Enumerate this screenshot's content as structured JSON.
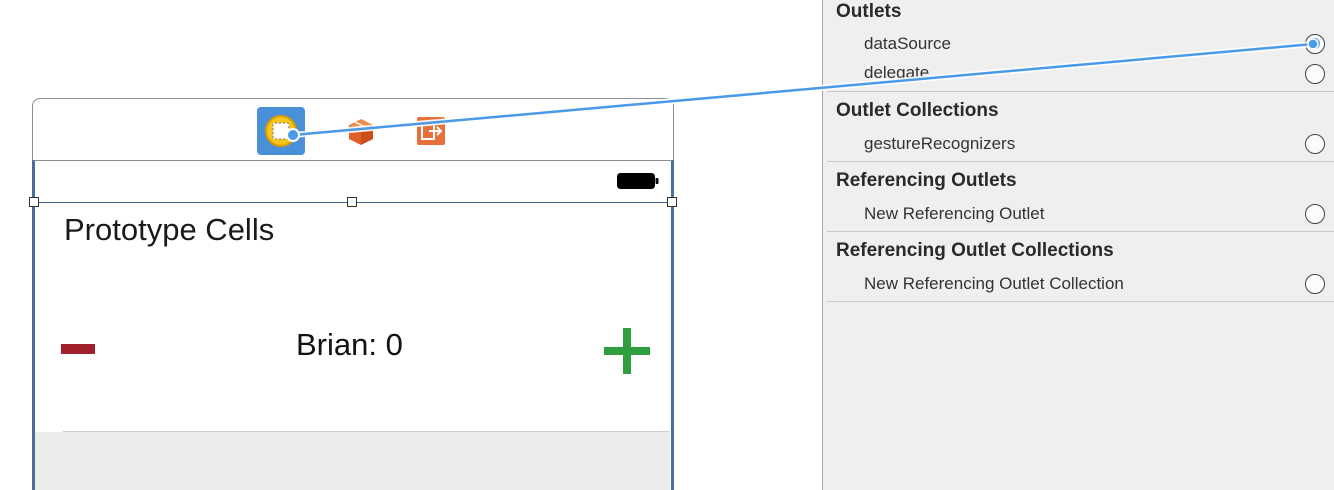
{
  "canvas": {
    "dock": {
      "icons": [
        "table-view-controller-icon",
        "first-responder-cube-icon",
        "exit-icon"
      ]
    },
    "status_bar": {
      "battery_icon": "battery-icon"
    },
    "table": {
      "title": "Prototype Cells",
      "cell": {
        "label": "Brian: 0",
        "minus_icon": "minus-icon",
        "plus_icon": "plus-icon"
      }
    }
  },
  "connections_panel": {
    "sections": [
      {
        "header": "Outlets",
        "rows": [
          {
            "label": "dataSource",
            "connected": true
          },
          {
            "label": "delegate",
            "connected": false
          }
        ]
      },
      {
        "header": "Outlet Collections",
        "rows": [
          {
            "label": "gestureRecognizers",
            "connected": false
          }
        ]
      },
      {
        "header": "Referencing Outlets",
        "rows": [
          {
            "label": "New Referencing Outlet",
            "connected": false
          }
        ]
      },
      {
        "header": "Referencing Outlet Collections",
        "rows": [
          {
            "label": "New Referencing Outlet Collection",
            "connected": false
          }
        ]
      }
    ]
  },
  "colors": {
    "connection_line": "#4a9ae8",
    "minus": "#a0202c",
    "plus": "#2e9e3e",
    "selection": "#3c5e92"
  }
}
